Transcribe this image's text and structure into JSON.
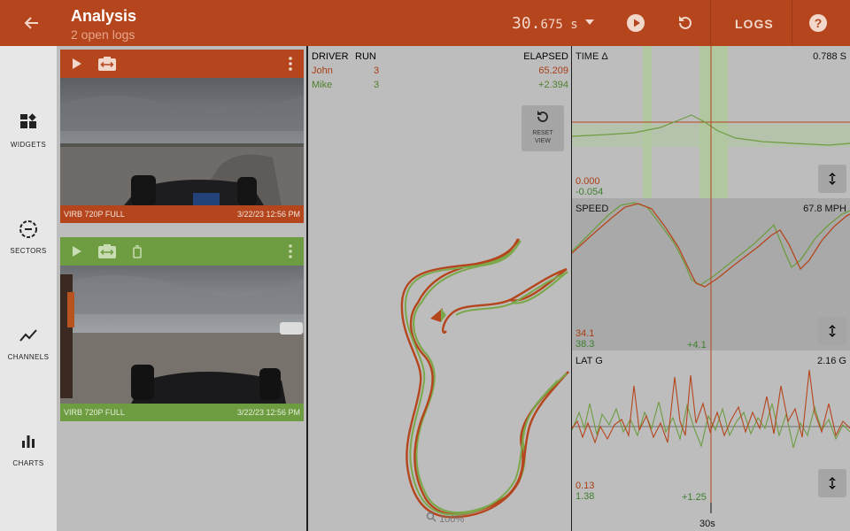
{
  "header": {
    "title": "Analysis",
    "subtitle": "2 open logs",
    "time_main": "30.",
    "time_frac": "675 s",
    "logs_label": "LOGS",
    "icons": [
      "back-arrow-icon",
      "dropdown-caret-icon",
      "play-circle-icon",
      "replay-icon",
      "help-icon"
    ]
  },
  "rail": {
    "items": [
      {
        "label": "WIDGETS",
        "icon": "widgets-icon"
      },
      {
        "label": "SECTORS",
        "icon": "sectors-icon"
      },
      {
        "label": "CHANNELS",
        "icon": "channels-icon"
      },
      {
        "label": "CHARTS",
        "icon": "charts-icon"
      }
    ]
  },
  "videos": [
    {
      "caption": "VIRB 720P FULL",
      "timestamp": "3/22/23 12:56 PM",
      "color": "#b5451c"
    },
    {
      "caption": "VIRB 720P FULL",
      "timestamp": "3/22/23 12:56 PM",
      "color": "#6e9c41"
    }
  ],
  "runs": {
    "headers": {
      "driver": "DRIVER",
      "run": "RUN",
      "elapsed": "ELAPSED"
    },
    "rows": [
      {
        "driver": "John",
        "run": "3",
        "elapsed": "65.209",
        "color": "#b5451c"
      },
      {
        "driver": "Mike",
        "run": "3",
        "elapsed": "+2.394",
        "color": "#5c8f2f"
      }
    ]
  },
  "map": {
    "reset_line1": "RESET",
    "reset_line2": "VIEW",
    "zoom": "100%"
  },
  "charts": [
    {
      "title": "TIME Δ",
      "value": "0.788 S",
      "low_red": "0.000",
      "low_green": "-0.054",
      "delta": ""
    },
    {
      "title": "SPEED",
      "value": "67.8 MPH",
      "low_red": "34.1",
      "low_green": "38.3",
      "delta": "+4.1"
    },
    {
      "title": "LAT G",
      "value": "2.16 G",
      "low_red": "0.13",
      "low_green": "1.38",
      "delta": "+1.25"
    }
  ],
  "x_axis": {
    "tick": "30s"
  },
  "colors": {
    "accent": "#b5451c",
    "driver1": "#b5451c",
    "driver2": "#6e9c41"
  }
}
